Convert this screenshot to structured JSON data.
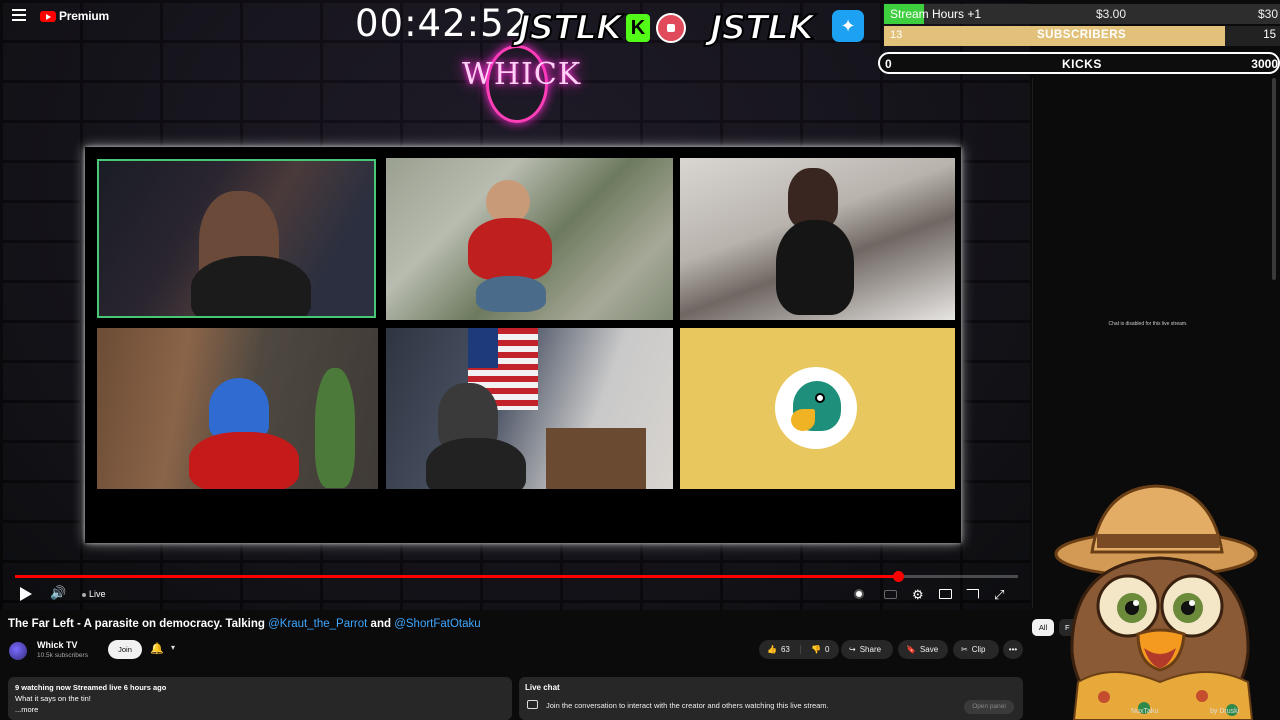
{
  "app": {
    "brand": "Premium"
  },
  "stream_overlay": {
    "timer": "00:42:52",
    "jstlk_left": "JSTLK",
    "kick_glyph": "K",
    "jstlk_right": "JSTLK",
    "twitter_glyph": "✦",
    "neon_logo": "WHICK"
  },
  "goals": {
    "stream_hours": {
      "label": "Stream Hours +1",
      "current": "$3.00",
      "target": "$30",
      "progress": 0.1
    },
    "subscribers": {
      "count": "13",
      "label": "SUBSCRIBERS",
      "target": "15"
    },
    "kicks": {
      "count": "0",
      "label": "KICKS",
      "target": "3000"
    }
  },
  "player": {
    "live_label": "Live",
    "progress_fraction": 0.88,
    "colors": {
      "progress": "#ff0000",
      "accent": "#3ea6ff"
    }
  },
  "video": {
    "title_prefix": "The Far Left - A parasite on democracy. Talking ",
    "mention1": "@Kraut_the_Parrot",
    "title_and": " and ",
    "mention2": "@ShortFatOtaku"
  },
  "channel": {
    "name": "Whick TV",
    "subscribers": "10.5k subscribers",
    "join_label": "Join"
  },
  "actions": {
    "like_count": "63",
    "dislike_count": "0",
    "share_label": "Share",
    "save_label": "Save",
    "clip_label": "Clip"
  },
  "description": {
    "meta": "9 watching now  Streamed live 6 hours ago",
    "text": "What it says on the tin!",
    "more": "...more"
  },
  "live_chat": {
    "title": "Live chat",
    "prompt": "Join the conversation to interact with the creator and others watching this live stream.",
    "open_panel": "Open panel",
    "disabled_notice": "Chat is disabled for this live stream."
  },
  "chat_filters": {
    "all": "All",
    "f": "F"
  },
  "bottom_strip": {
    "user1": "NuxTaku",
    "user2": "by Druski"
  }
}
